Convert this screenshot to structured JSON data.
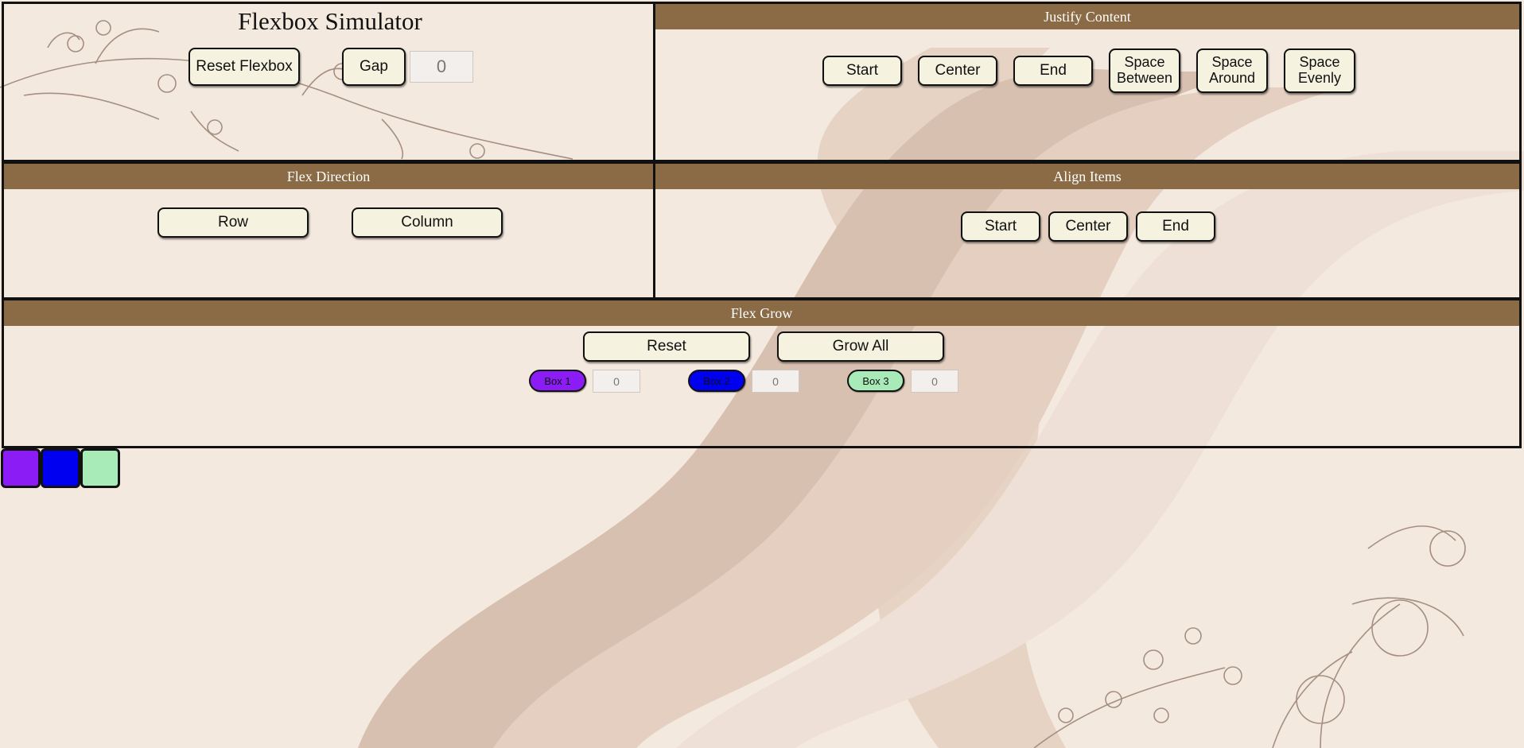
{
  "colors": {
    "bar": "#8a6b45",
    "button_bg": "#f5f3df",
    "page_bg": "#f4e9df",
    "box1": "#8b1cf5",
    "box2": "#0000f0",
    "box3": "#a8ebb8"
  },
  "header": {
    "title": "Flexbox Simulator",
    "reset_label": "Reset Flexbox",
    "gap_label": "Gap",
    "gap_value": "0"
  },
  "justify": {
    "title": "Justify Content",
    "start": "Start",
    "center": "Center",
    "end": "End",
    "between_1": "Space",
    "between_2": "Between",
    "around_1": "Space",
    "around_2": "Around",
    "evenly_1": "Space",
    "evenly_2": "Evenly"
  },
  "direction": {
    "title": "Flex Direction",
    "row": "Row",
    "column": "Column"
  },
  "align": {
    "title": "Align Items",
    "start": "Start",
    "center": "Center",
    "end": "End"
  },
  "grow": {
    "title": "Flex Grow",
    "reset": "Reset",
    "grow_all": "Grow All",
    "box1_label": "Box 1",
    "box1_value": "0",
    "box2_label": "Box 2",
    "box2_value": "0",
    "box3_label": "Box 3",
    "box3_value": "0"
  }
}
